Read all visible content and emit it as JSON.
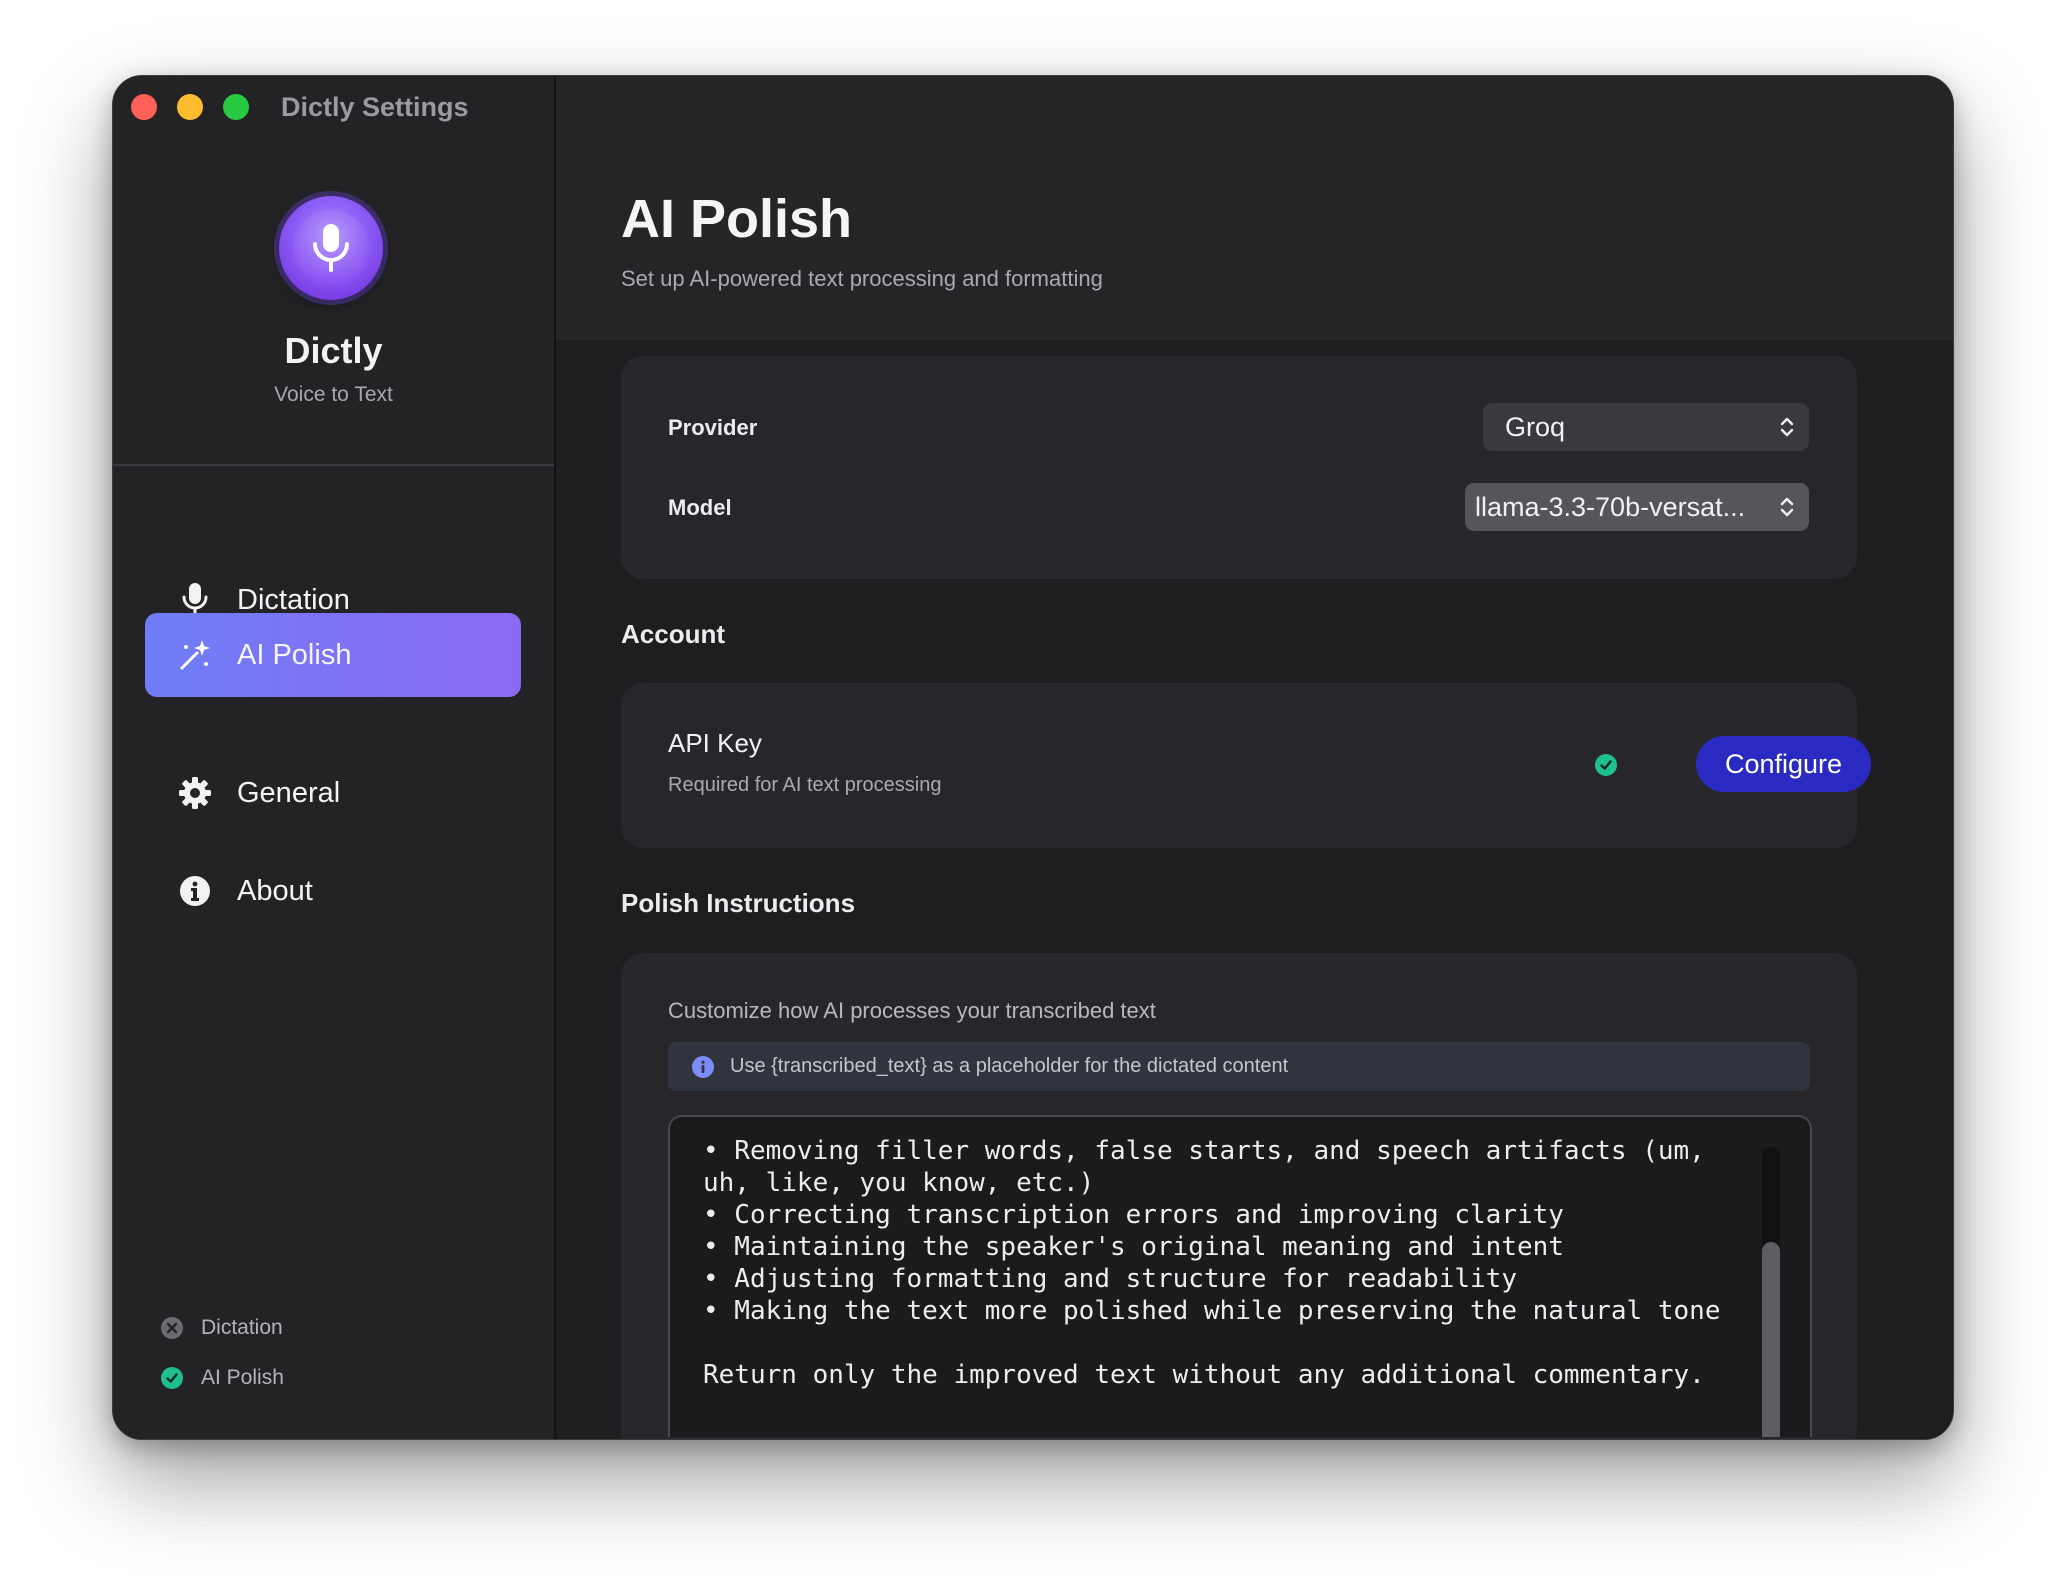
{
  "window": {
    "title": "Dictly Settings"
  },
  "sidebar": {
    "app_name": "Dictly",
    "app_subtitle": "Voice to Text",
    "nav": [
      {
        "label": "Dictation",
        "icon": "microphone-icon",
        "active": false
      },
      {
        "label": "AI Polish",
        "icon": "magic-wand-icon",
        "active": true
      },
      {
        "label": "General",
        "icon": "gear-icon",
        "active": false
      },
      {
        "label": "About",
        "icon": "info-icon",
        "active": false
      }
    ],
    "status": [
      {
        "label": "Dictation",
        "state": "inactive",
        "icon": "x-circle-icon"
      },
      {
        "label": "AI Polish",
        "state": "active",
        "icon": "check-circle-icon"
      }
    ]
  },
  "main": {
    "title": "AI Polish",
    "subtitle": "Set up AI-powered text processing and formatting",
    "provider": {
      "label": "Provider",
      "value": "Groq"
    },
    "model": {
      "label": "Model",
      "value": "llama-3.3-70b-versat..."
    },
    "account": {
      "section_title": "Account",
      "api_key_label": "API Key",
      "api_key_desc": "Required for AI text processing",
      "configure_label": "Configure"
    },
    "instructions": {
      "section_title": "Polish Instructions",
      "desc": "Customize how AI processes your transcribed text",
      "info": "Use {transcribed_text} as a placeholder for the dictated content",
      "text": "• Removing filler words, false starts, and speech artifacts (um, uh, like, you know, etc.)\n• Correcting transcription errors and improving clarity\n• Maintaining the speaker's original meaning and intent\n• Adjusting formatting and structure for readability\n• Making the text more polished while preserving the natural tone\n\nReturn only the improved text without any additional commentary."
    }
  },
  "colors": {
    "accent_start": "#6f7df6",
    "accent_end": "#8b6af2",
    "configure_button": "#2a2ac2",
    "status_ok": "#1fbf8f"
  }
}
